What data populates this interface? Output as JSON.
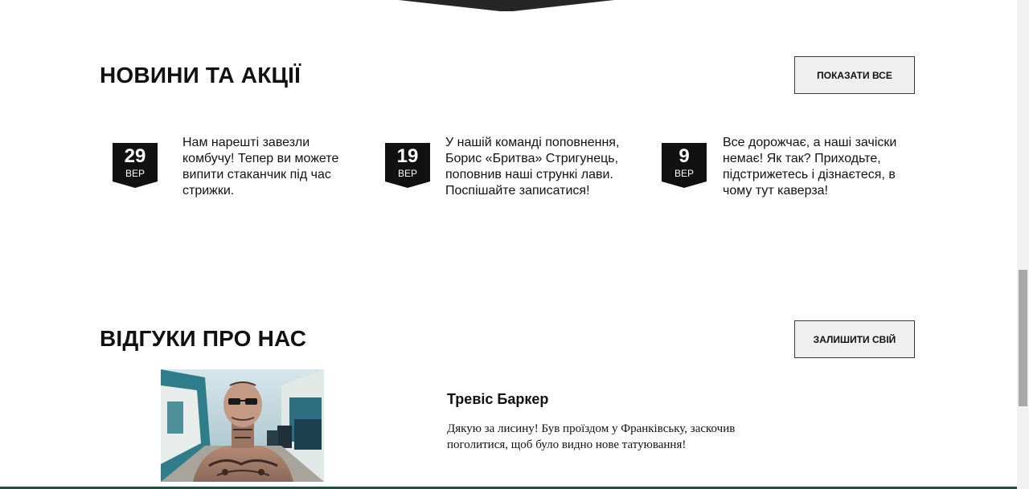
{
  "news": {
    "title": "НОВИНИ ТА АКЦІЇ",
    "show_all_label": "ПОКАЗАТИ ВСЕ",
    "items": [
      {
        "day": "29",
        "month": "ВЕР",
        "text": "Нам нарешті завезли комбучу! Тепер ви можете випити стаканчик під час стрижки."
      },
      {
        "day": "19",
        "month": "ВЕР",
        "text": "У нашій команді поповнення, Борис «Бритва» Стригунець, поповнив наші стрункі лави. Поспішайте записатися!"
      },
      {
        "day": "9",
        "month": "ВЕР",
        "text": "Все дорожчає, а наші зачіски немає! Як так? Приходьте, підстрижетесь і дізнаєтеся, в чому тут каверза!"
      }
    ]
  },
  "reviews": {
    "title": "ВІДГУКИ ПРО НАС",
    "leave_label": "ЗАЛИШИТИ СВІЙ",
    "items": [
      {
        "name": "Тревіс Баркер",
        "text": "Дякую за лисину! Був проїздом у Франківську, заскочив поголитися, щоб було видно нове татуювання!"
      }
    ]
  },
  "colors": {
    "badge": "#111111",
    "button_bg": "#efefef",
    "accent_line": "#1f4f3f"
  }
}
